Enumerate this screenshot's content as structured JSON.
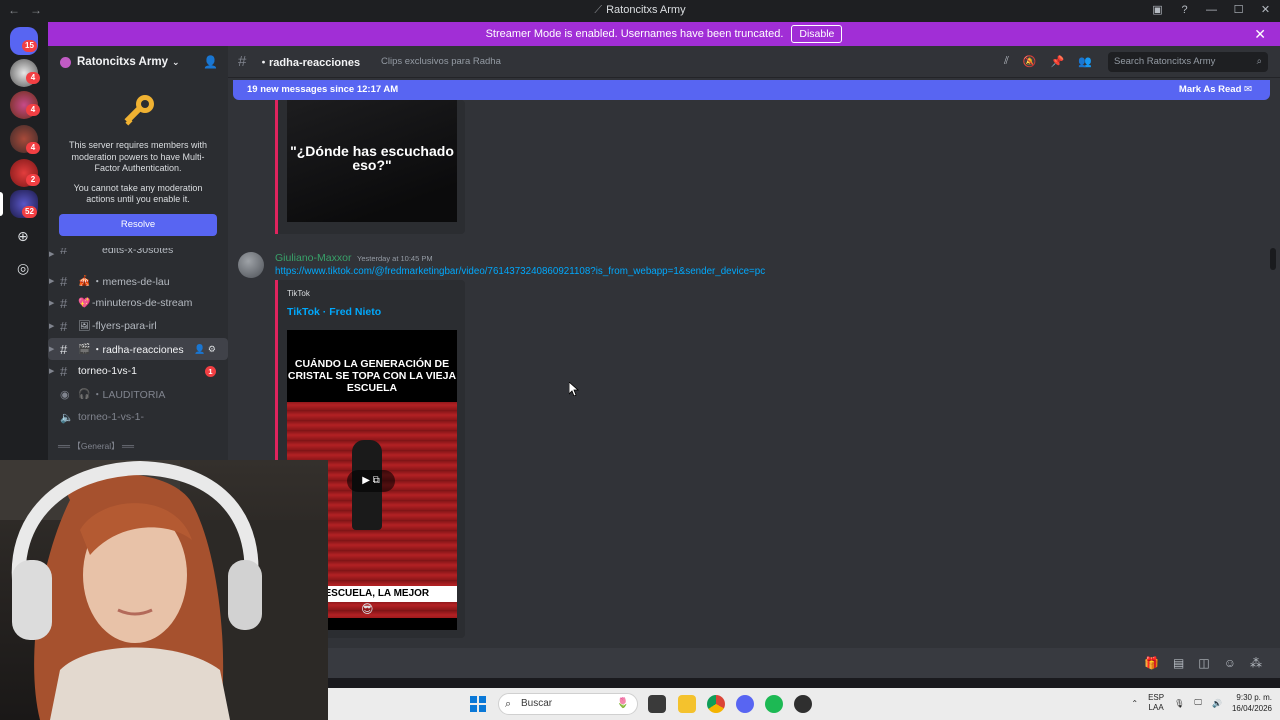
{
  "window": {
    "title": "Ratoncitxs Army"
  },
  "rail": {
    "badges": [
      "15",
      "4",
      "4",
      "4",
      "2",
      "52"
    ]
  },
  "streamer_banner": {
    "text": "Streamer Mode is enabled. Usernames have been truncated.",
    "disable_label": "Disable"
  },
  "sidebar": {
    "server_name": "Ratoncitxs Army",
    "mfa_text_1": "This server requires members with moderation powers to have Multi-Factor Authentication.",
    "mfa_text_2": "You cannot take any moderation actions until you enable it.",
    "resolve_label": "Resolve",
    "channels": [
      {
        "emoji": "",
        "name": "edits-x-30sotes"
      },
      {
        "emoji": "🎪",
        "name": "・memes-de-lau"
      },
      {
        "emoji": "💖",
        "name": "-minuteros-de-stream"
      },
      {
        "emoji": "🖼",
        "name": "-flyers-para-irl"
      },
      {
        "emoji": "🎬",
        "name": "・radha-reacciones"
      },
      {
        "emoji": "",
        "name": "torneo-1vs-1",
        "unread": "1"
      },
      {
        "emoji": "🎧",
        "name": "・LAUDITORIA"
      },
      {
        "emoji": "",
        "name": "torneo-1-vs-1-"
      }
    ],
    "category": "══ 【General】 ══"
  },
  "channel_header": {
    "name": "・radha-reacciones",
    "topic": "Clips exclusivos para Radha",
    "search_placeholder": "Search Ratoncitxs Army"
  },
  "new_messages": {
    "text": "19 new messages since 12:17 AM",
    "action": "Mark As Read"
  },
  "top_embed": {
    "quote": "\"¿Dónde has escuchado eso?\""
  },
  "message": {
    "author": "Giuliano-Maxxor",
    "timestamp": "Yesterday at 10:45 PM",
    "link": "https://www.tiktok.com/@fredmarketingbar/video/7614373240860921108?is_from_webapp=1&sender_device=pc",
    "embed": {
      "provider": "TikTok",
      "title": "TikTok · Fred Nieto",
      "thumb_headline": "CUÁNDO LA GENERACIÓN DE CRISTAL SE TOPA CON LA VIEJA ESCUELA",
      "thumb_footer": "A ESCUELA, LA MEJOR",
      "thumb_emoji": "😎"
    }
  },
  "taskbar": {
    "search_placeholder": "Buscar",
    "lang_1": "ESP",
    "lang_2": "LAA",
    "time": "9:30 p. m.",
    "date": "16/04/2026"
  },
  "colors": {
    "streamer": "#a12ed6",
    "blurple": "#5865f2",
    "embed_accent": "#e0245e",
    "link": "#00a8fc",
    "author": "#38a169"
  }
}
